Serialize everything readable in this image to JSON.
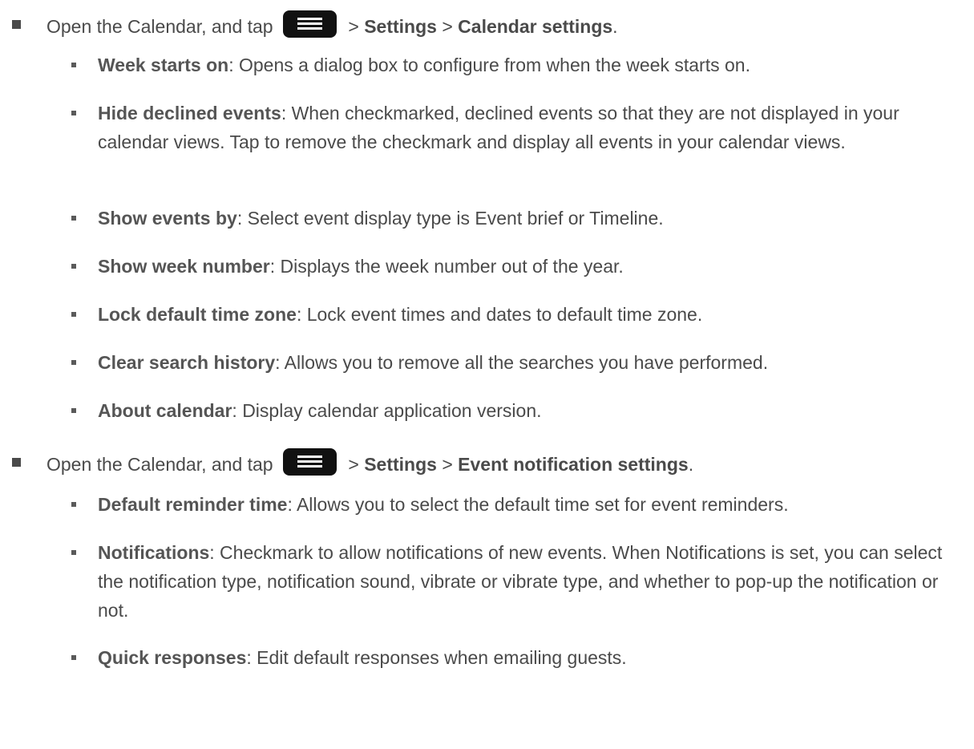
{
  "sections": [
    {
      "intro": "Open the Calendar, and tap",
      "icon": "menu-icon",
      "path_sep": ">",
      "path1": "Settings",
      "path2": "Calendar settings",
      "end": ".",
      "items": [
        {
          "term": "Week starts on",
          "desc": ": Opens a dialog box to configure from when the week starts on."
        },
        {
          "term": "Hide declined events",
          "desc": ": When checkmarked, declined events so that they are not displayed in your calendar views. Tap to remove the checkmark and display all events in your calendar views."
        },
        {
          "term": "Show events by",
          "desc": ": Select event display type is Event brief or Timeline."
        },
        {
          "term": "Show week number",
          "desc": ": Displays the week number out of the year."
        },
        {
          "term": "Lock default time zone",
          "desc": ": Lock event times and dates to default time zone."
        },
        {
          "term": "Clear search history",
          "desc": ": Allows you to remove all the searches you have performed."
        },
        {
          "term": "About calendar",
          "desc": ": Display calendar application version."
        }
      ]
    },
    {
      "intro": "Open the Calendar, and tap",
      "icon": "menu-icon",
      "path_sep": ">",
      "path1": "Settings",
      "path2": "Event notification settings",
      "end": ".",
      "items": [
        {
          "term": "Default reminder time",
          "desc": ": Allows you to select the default time set for event reminders."
        },
        {
          "term": "Notifications",
          "desc": ": Checkmark to allow notifications of new events. When Notifications is set, you can select the notification type, notification sound, vibrate or vibrate type, and whether to pop-up the notification or not."
        },
        {
          "term": "Quick responses",
          "desc": ": Edit default responses when emailing guests."
        }
      ]
    }
  ]
}
